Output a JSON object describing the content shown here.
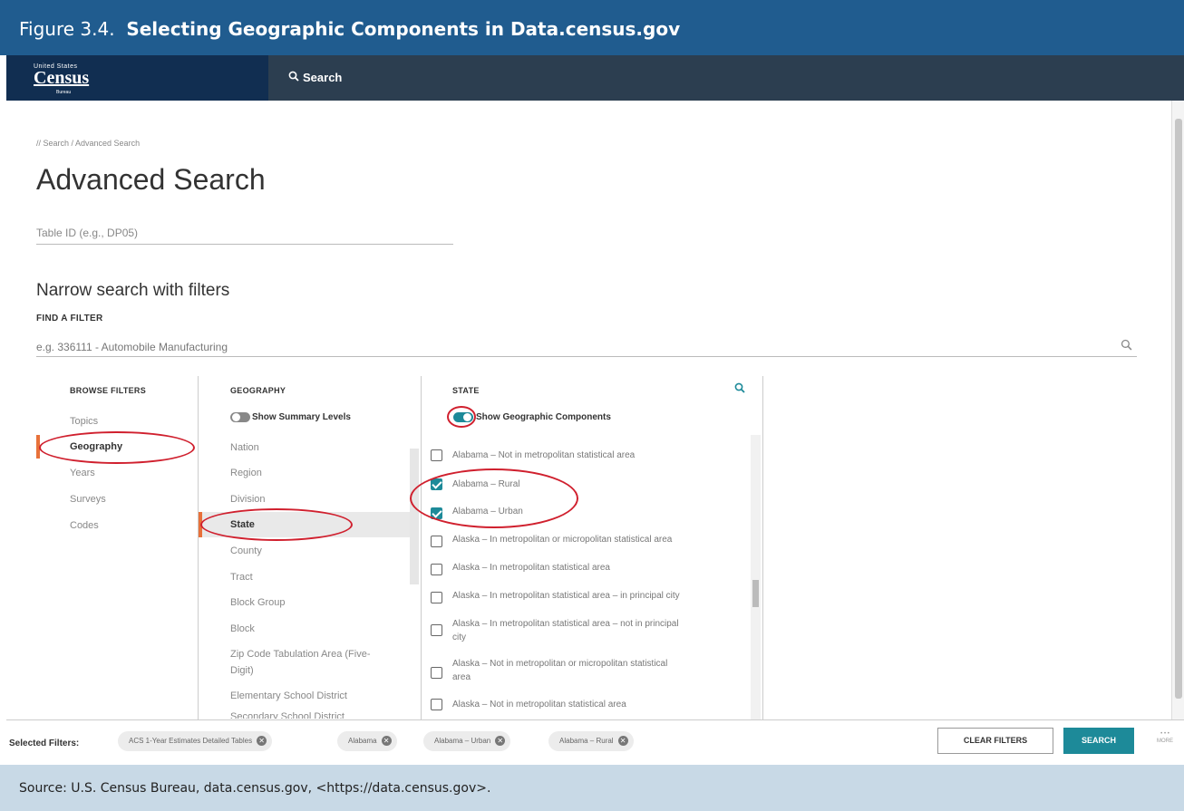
{
  "figure": {
    "prefix": "Figure 3.4.",
    "title": "Selecting Geographic Components in Data.census.gov"
  },
  "header": {
    "logo_small": "United States",
    "logo_big": "Census",
    "logo_tiny": "Bureau",
    "search_label": "Search"
  },
  "breadcrumb": "// Search / Advanced Search",
  "page_title": "Advanced Search",
  "table_id_placeholder": "Table ID (e.g., DP05)",
  "narrow_heading": "Narrow search with filters",
  "find_filter": {
    "label": "FIND A FILTER",
    "placeholder": "e.g. 336111 - Automobile Manufacturing"
  },
  "browse": {
    "title": "BROWSE FILTERS",
    "items": [
      "Topics",
      "Geography",
      "Years",
      "Surveys",
      "Codes"
    ]
  },
  "geography": {
    "title": "GEOGRAPHY",
    "toggle_label": "Show Summary Levels",
    "items": [
      "Nation",
      "Region",
      "Division",
      "State",
      "County",
      "Tract",
      "Block Group",
      "Block",
      "Zip Code Tabulation Area (Five-",
      "Digit)",
      "Elementary School District",
      "Secondary School District"
    ]
  },
  "state": {
    "title": "STATE",
    "toggle_label": "Show Geographic Components",
    "items": [
      {
        "line1": "Alabama – Not in metropolitan statistical area",
        "line2": "",
        "checked": false
      },
      {
        "line1": "Alabama – Rural",
        "line2": "",
        "checked": true
      },
      {
        "line1": "Alabama – Urban",
        "line2": "",
        "checked": true
      },
      {
        "line1": "Alaska – In metropolitan or micropolitan statistical area",
        "line2": "",
        "checked": false
      },
      {
        "line1": "Alaska – In metropolitan statistical area",
        "line2": "",
        "checked": false
      },
      {
        "line1": "Alaska – In metropolitan statistical area – in principal city",
        "line2": "",
        "checked": false
      },
      {
        "line1": "Alaska – In metropolitan statistical area – not in principal",
        "line2": "city",
        "checked": false
      },
      {
        "line1": "Alaska – Not in metropolitan or micropolitan statistical",
        "line2": "area",
        "checked": false
      },
      {
        "line1": "Alaska – Not in metropolitan statistical area",
        "line2": "",
        "checked": false
      }
    ]
  },
  "selected_filters": {
    "label": "Selected Filters:",
    "chips": [
      "ACS 1-Year Estimates Detailed Tables",
      "Alabama",
      "Alabama – Urban",
      "Alabama – Rural"
    ]
  },
  "buttons": {
    "clear": "CLEAR FILTERS",
    "search": "SEARCH",
    "more_dots": "• • •",
    "more": "MORE"
  },
  "colors": {
    "accent": "#1d8a99",
    "highlight": "#d0202e",
    "nav": "#112e51",
    "figure_header": "#205c8f",
    "active_bar": "#e8713a"
  },
  "source": "Source: U.S. Census Bureau, data.census.gov, <https://data.census.gov>."
}
